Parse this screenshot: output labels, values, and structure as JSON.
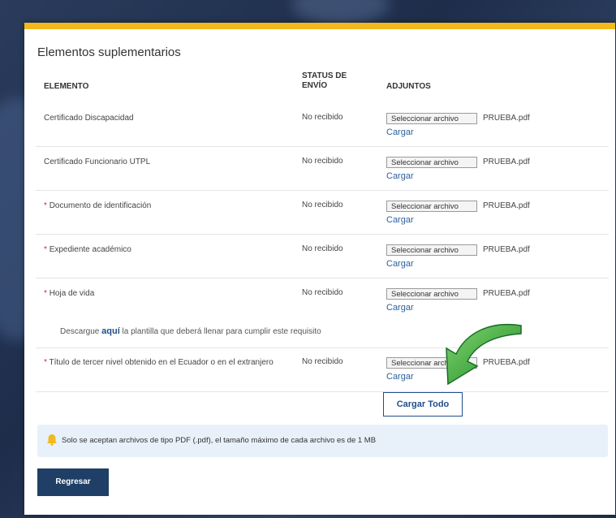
{
  "section_title": "Elementos suplementarios",
  "headers": {
    "element": "ELEMENTO",
    "status_line1": "STATUS DE",
    "status_line2": "ENVÍO",
    "attachments": "ADJUNTOS"
  },
  "rows": [
    {
      "required": false,
      "label": "Certificado Discapacidad",
      "status": "No recibido",
      "file_button": "Seleccionar archivo",
      "file_name": "PRUEBA.pdf",
      "upload": "Cargar"
    },
    {
      "required": false,
      "label": "Certificado Funcionario UTPL",
      "status": "No recibido",
      "file_button": "Seleccionar archivo",
      "file_name": "PRUEBA.pdf",
      "upload": "Cargar"
    },
    {
      "required": true,
      "label": "Documento de identificación",
      "status": "No recibido",
      "file_button": "Seleccionar archivo",
      "file_name": "PRUEBA.pdf",
      "upload": "Cargar"
    },
    {
      "required": true,
      "label": "Expediente académico",
      "status": "No recibido",
      "file_button": "Seleccionar archivo",
      "file_name": "PRUEBA.pdf",
      "upload": "Cargar"
    },
    {
      "required": true,
      "label": "Hoja de vida",
      "status": "No recibido",
      "file_button": "Seleccionar archivo",
      "file_name": "PRUEBA.pdf",
      "upload": "Cargar"
    },
    {
      "required": true,
      "label": "Título de tercer nivel obtenido en el Ecuador o en el extranjero",
      "status": "No recibido",
      "file_button": "Seleccionar archivo",
      "file_name": "PRUEBA.pdf",
      "upload": "Cargar"
    }
  ],
  "template_note": {
    "prefix": "Descargue",
    "link": "aquí",
    "suffix": "la plantilla que deberá llenar para cumplir este requisito"
  },
  "required_mark": "*",
  "upload_all_label": "Cargar Todo",
  "info_text": "Solo se aceptan archivos de tipo PDF (.pdf), el tamaño máximo de cada archivo es de 1 MB",
  "back_label": "Regresar",
  "colors": {
    "accent_top": "#f2b81c",
    "primary": "#1f3f66",
    "link": "#2a5f9e",
    "required": "#d9242c",
    "arrow": "#2e9e3a",
    "info_bg": "#e8f1fa"
  },
  "icons": {
    "info": "bell-icon",
    "annotation": "curved-arrow-icon"
  }
}
